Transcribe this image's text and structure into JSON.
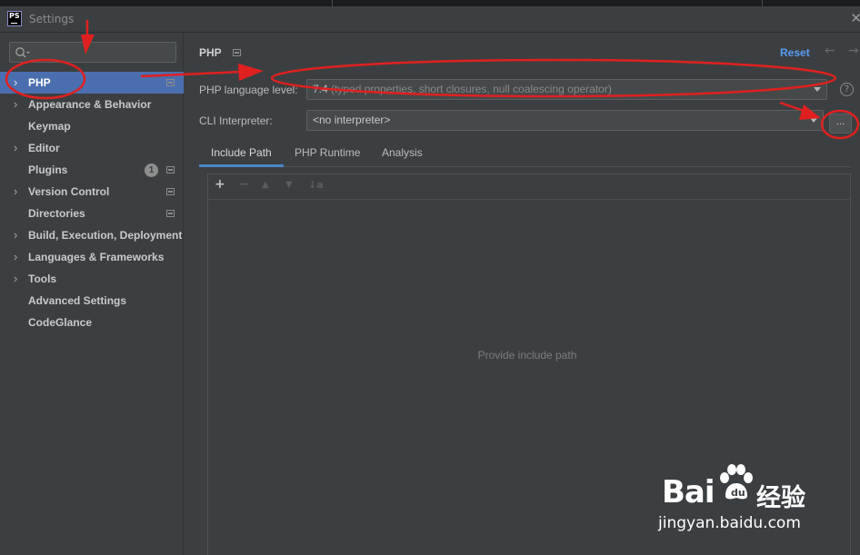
{
  "window": {
    "title": "Settings",
    "logo_text": "PS"
  },
  "sidebar": {
    "search_placeholder": "",
    "items": [
      {
        "label": "PHP",
        "expandable": true,
        "project_icon": true,
        "selected": true
      },
      {
        "label": "Appearance & Behavior",
        "expandable": true,
        "project_icon": false
      },
      {
        "label": "Keymap",
        "expandable": false,
        "project_icon": false
      },
      {
        "label": "Editor",
        "expandable": true,
        "project_icon": false
      },
      {
        "label": "Plugins",
        "expandable": false,
        "project_icon": true,
        "badge": "1"
      },
      {
        "label": "Version Control",
        "expandable": true,
        "project_icon": true
      },
      {
        "label": "Directories",
        "expandable": false,
        "project_icon": true
      },
      {
        "label": "Build, Execution, Deployment",
        "expandable": true,
        "project_icon": false
      },
      {
        "label": "Languages & Frameworks",
        "expandable": true,
        "project_icon": false
      },
      {
        "label": "Tools",
        "expandable": true,
        "project_icon": false
      },
      {
        "label": "Advanced Settings",
        "expandable": false,
        "project_icon": false
      },
      {
        "label": "CodeGlance",
        "expandable": false,
        "project_icon": false
      }
    ]
  },
  "header": {
    "title": "PHP",
    "reset_label": "Reset"
  },
  "form": {
    "language_level": {
      "label": "PHP language level:",
      "value": "7.4",
      "description": " (typed properties, short closures, null coalescing operator)"
    },
    "cli_interpreter": {
      "label": "CLI Interpreter:",
      "value": "<no interpreter>",
      "browse_label": "..."
    },
    "help_label": "?"
  },
  "tabs": [
    {
      "label": "Include Path",
      "active": true
    },
    {
      "label": "PHP Runtime",
      "active": false
    },
    {
      "label": "Analysis",
      "active": false
    }
  ],
  "include_path": {
    "empty_text": "Provide include path",
    "toolbar": {
      "add": "+",
      "remove": "−",
      "up": "▲",
      "down": "▼",
      "sort": "↓a"
    }
  },
  "annotation_color": "#e02020",
  "watermark": {
    "brand_left": "Bai",
    "brand_right": "经验",
    "url": "jingyan.baidu.com"
  }
}
